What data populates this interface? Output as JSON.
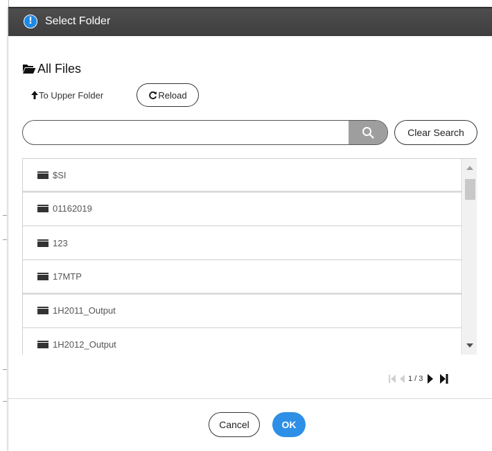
{
  "dialog": {
    "title": "Select Folder",
    "title_icon": "info-icon",
    "accent_color": "#2e8fe6",
    "title_bar_color": "#444444"
  },
  "location": {
    "root_label": "All Files",
    "root_icon": "folder-open-icon"
  },
  "toolbar": {
    "upper_folder_label": "To Upper Folder",
    "upper_folder_icon": "arrow-up-icon",
    "reload_label": "Reload",
    "reload_icon": "refresh-icon"
  },
  "search": {
    "value": "",
    "placeholder": "",
    "button_icon": "search-icon",
    "clear_label": "Clear Search"
  },
  "folders": [
    {
      "name": "$SI",
      "icon": "folder-icon"
    },
    {
      "name": "01162019",
      "icon": "folder-icon"
    },
    {
      "name": "123",
      "icon": "folder-icon"
    },
    {
      "name": "17MTP",
      "icon": "folder-icon"
    },
    {
      "name": "1H2011_Output",
      "icon": "folder-icon"
    },
    {
      "name": "1H2012_Output",
      "icon": "folder-icon"
    }
  ],
  "pagination": {
    "text": "1 / 3",
    "current_page": 1,
    "total_pages": 3
  },
  "footer": {
    "cancel_label": "Cancel",
    "ok_label": "OK"
  }
}
